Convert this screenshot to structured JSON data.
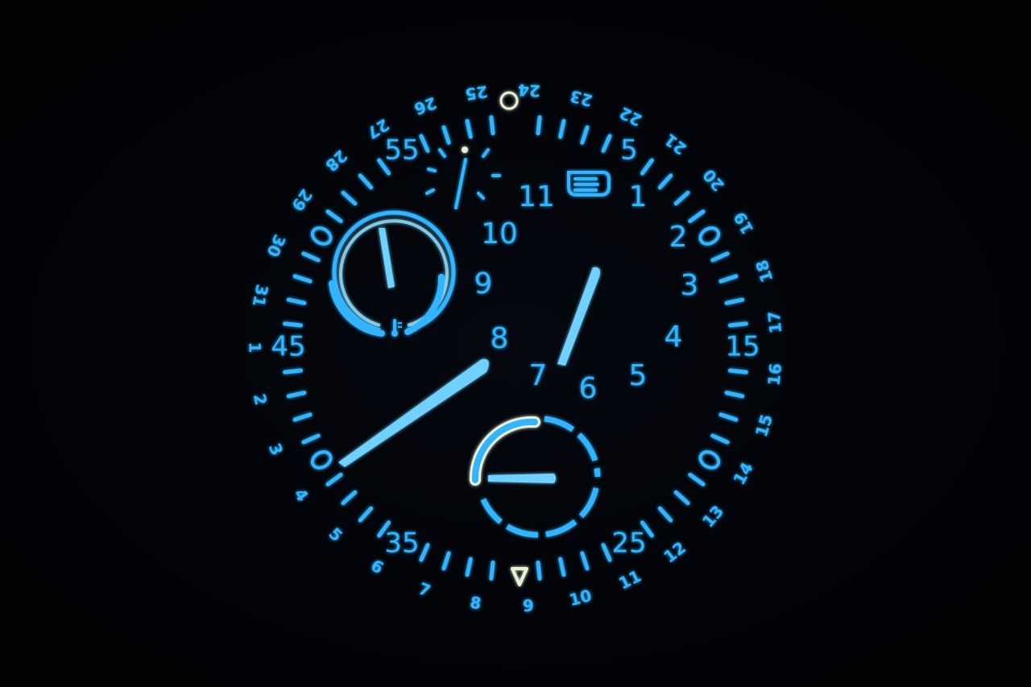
{
  "colors": {
    "background": "#020306",
    "lume": "#31b4ff",
    "lume_bright": "#8fe0ff",
    "lume_dim": "#1f88d8",
    "white_lume": "#e8f0d8",
    "hand": "#6fd1ff"
  },
  "date_ring": {
    "labels": [
      "24",
      "23",
      "22",
      "21",
      "20",
      "19",
      "18",
      "17",
      "16",
      "15",
      "14",
      "13",
      "12",
      "11",
      "10",
      "9",
      "8",
      "7",
      "6",
      "5",
      "4",
      "3",
      "2",
      "1",
      "31",
      "30",
      "29",
      "28",
      "27",
      "26",
      "25"
    ]
  },
  "minute_ring": {
    "labels": [
      "5",
      "15",
      "25",
      "35",
      "45",
      "55"
    ]
  },
  "hour_numerals": {
    "labels": [
      "1",
      "2",
      "3",
      "4",
      "5",
      "6",
      "7",
      "8",
      "9",
      "10",
      "11"
    ]
  },
  "icons": {
    "top_marker": "ring-marker-icon",
    "bottom_marker": "triangle-marker-icon",
    "hour_12": "hand-icon",
    "temperature": "thermometer-icon",
    "depth_gauge": "depth-gauge-icon",
    "small_seconds": "burst-indicator-icon"
  }
}
